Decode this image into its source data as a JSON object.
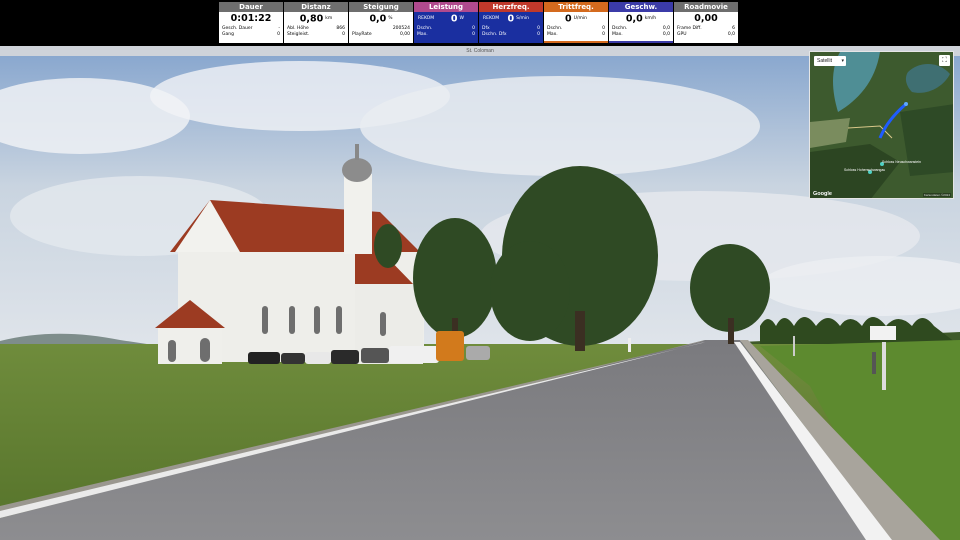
{
  "tiles": [
    {
      "id": "dauer",
      "title": "Dauer",
      "value": "0:01:22",
      "unit": "",
      "rows": [
        [
          "Gesch. Dauer",
          "-"
        ],
        [
          "Gang",
          "0"
        ]
      ]
    },
    {
      "id": "distanz",
      "title": "Distanz",
      "value": "0,80",
      "unit": "km",
      "rows": [
        [
          "Abl. Höhe",
          "866"
        ],
        [
          "Steigleist.",
          "0"
        ]
      ]
    },
    {
      "id": "steigung",
      "title": "Steigung",
      "value": "0,0",
      "unit": "%",
      "rows": [
        [
          "",
          "200524"
        ],
        [
          "PlayRate",
          "0,00"
        ]
      ]
    },
    {
      "id": "leistung",
      "title": "Leistung",
      "value": "0",
      "unit": "W",
      "label": "REKOM",
      "rows": [
        [
          "Dschn.",
          "0"
        ],
        [
          "Max.",
          "0"
        ]
      ]
    },
    {
      "id": "herzfreq",
      "title": "Herzfreq.",
      "value": "0",
      "unit": "S/min",
      "label": "REKOM",
      "rows": [
        [
          "Dfx",
          "0"
        ],
        [
          "Dschn. Dfx",
          "0"
        ]
      ]
    },
    {
      "id": "trittfreq",
      "title": "Trittfreq.",
      "value": "0",
      "unit": "U/min",
      "rows": [
        [
          "Dschn.",
          "0"
        ],
        [
          "Max.",
          "0"
        ]
      ]
    },
    {
      "id": "geschw",
      "title": "Geschw.",
      "value": "0,0",
      "unit": "km/h",
      "rows": [
        [
          "Dschn.",
          "0,0"
        ],
        [
          "Max.",
          "0,0"
        ]
      ]
    },
    {
      "id": "roadmovie",
      "title": "Roadmovie",
      "value": "0,00",
      "unit": "",
      "rows": [
        [
          "Frame Diff.",
          "6"
        ],
        [
          "GPU",
          "0,0"
        ]
      ]
    }
  ],
  "caption": "St. Coloman",
  "map": {
    "type_label": "Satellit",
    "fullscreen_icon": "fullscreen-icon",
    "brand": "Google",
    "attribution": "Kartendaten ©2024",
    "label_a": "Schloss Neuschwanstein",
    "label_b": "Schloss Hohenschwangau"
  },
  "colors": {
    "tile_header": "#6e6e6e",
    "tile_blue": "#1a2fa0",
    "route": "#1f5cff"
  }
}
